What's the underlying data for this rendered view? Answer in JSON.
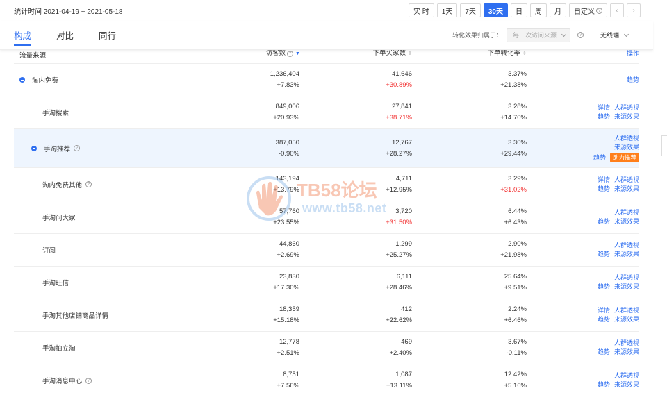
{
  "header": {
    "stat_time": "统计时间 2021-04-19 ~ 2021-05-18",
    "time_buttons": [
      "实 时",
      "1天",
      "7天",
      "30天",
      "日",
      "周",
      "月",
      "自定义"
    ],
    "active_time": "30天",
    "prev_icon": "chevron-left-icon",
    "next_icon": "chevron-right-icon"
  },
  "tabs": [
    {
      "label": "构成",
      "active": true
    },
    {
      "label": "对比",
      "active": false
    },
    {
      "label": "同行",
      "active": false
    }
  ],
  "attribution": {
    "label": "转化效果归属于：",
    "selected": "每一次访问来源",
    "device": "无线端"
  },
  "columns": {
    "source": "流量来源",
    "visitors": "访客数",
    "buyers": "下单买家数",
    "rate": "下单转化率",
    "ops": "操作"
  },
  "rows": [
    {
      "name": "淘内免费",
      "level": 0,
      "visitors": "1,236,404",
      "visitors_delta": "+7.83%",
      "buyers": "41,646",
      "buyers_delta": "+30.89%",
      "buyers_delta_red": true,
      "rate": "3.37%",
      "rate_delta": "+21.38%",
      "rate_delta_red": false,
      "ops_left": [
        "趋势"
      ],
      "ops_right": []
    },
    {
      "name": "手淘搜索",
      "level": 1,
      "visitors": "849,006",
      "visitors_delta": "+20.93%",
      "buyers": "27,841",
      "buyers_delta": "+38.71%",
      "buyers_delta_red": true,
      "rate": "3.28%",
      "rate_delta": "+14.70%",
      "rate_delta_red": false,
      "ops_left": [
        "详情",
        "趋势"
      ],
      "ops_right": [
        "人群透视",
        "来源效果"
      ]
    },
    {
      "name": "手淘推荐",
      "level": 1,
      "visitors": "387,050",
      "visitors_delta": "-0.90%",
      "buyers": "12,767",
      "buyers_delta": "+28.27%",
      "buyers_delta_red": false,
      "rate": "3.30%",
      "rate_delta": "+29.44%",
      "rate_delta_red": false,
      "ops_left": [
        "趋势"
      ],
      "ops_right": [
        "人群透视",
        "来源效果"
      ],
      "badge": "助力推荐"
    },
    {
      "name": "淘内免费其他",
      "level": 1,
      "visitors": "143,194",
      "visitors_delta": "+13.79%",
      "buyers": "4,711",
      "buyers_delta": "+12.95%",
      "buyers_delta_red": false,
      "rate": "3.29%",
      "rate_delta": "+31.02%",
      "rate_delta_red": true,
      "ops_left": [
        "详情",
        "趋势"
      ],
      "ops_right": [
        "人群透视",
        "来源效果"
      ]
    },
    {
      "name": "手淘问大家",
      "level": 1,
      "visitors": "57,760",
      "visitors_delta": "+23.55%",
      "buyers": "3,720",
      "buyers_delta": "+31.50%",
      "buyers_delta_red": true,
      "rate": "6.44%",
      "rate_delta": "+6.43%",
      "rate_delta_red": false,
      "ops_left": [
        "趋势"
      ],
      "ops_right": [
        "人群透视",
        "来源效果"
      ]
    },
    {
      "name": "订阅",
      "level": 1,
      "visitors": "44,860",
      "visitors_delta": "+2.69%",
      "buyers": "1,299",
      "buyers_delta": "+25.27%",
      "buyers_delta_red": false,
      "rate": "2.90%",
      "rate_delta": "+21.98%",
      "rate_delta_red": false,
      "ops_left": [
        "趋势"
      ],
      "ops_right": [
        "人群透视",
        "来源效果"
      ]
    },
    {
      "name": "手淘旺信",
      "level": 1,
      "visitors": "23,830",
      "visitors_delta": "+17.30%",
      "buyers": "6,111",
      "buyers_delta": "+28.46%",
      "buyers_delta_red": false,
      "rate": "25.64%",
      "rate_delta": "+9.51%",
      "rate_delta_red": false,
      "ops_left": [
        "趋势"
      ],
      "ops_right": [
        "人群透视",
        "来源效果"
      ]
    },
    {
      "name": "手淘其他店铺商品详情",
      "level": 1,
      "visitors": "18,359",
      "visitors_delta": "+15.18%",
      "buyers": "412",
      "buyers_delta": "+22.62%",
      "buyers_delta_red": false,
      "rate": "2.24%",
      "rate_delta": "+6.46%",
      "rate_delta_red": false,
      "ops_left": [
        "详情",
        "趋势"
      ],
      "ops_right": [
        "人群透视",
        "来源效果"
      ]
    },
    {
      "name": "手淘拍立淘",
      "level": 1,
      "visitors": "12,778",
      "visitors_delta": "+2.51%",
      "buyers": "469",
      "buyers_delta": "+2.40%",
      "buyers_delta_red": false,
      "rate": "3.67%",
      "rate_delta": "-0.11%",
      "rate_delta_red": false,
      "ops_left": [
        "趋势"
      ],
      "ops_right": [
        "人群透视",
        "来源效果"
      ]
    },
    {
      "name": "手淘消息中心",
      "level": 1,
      "visitors": "8,751",
      "visitors_delta": "+7.56%",
      "buyers": "1,087",
      "buyers_delta": "+13.11%",
      "buyers_delta_red": false,
      "rate": "12.42%",
      "rate_delta": "+5.16%",
      "rate_delta_red": false,
      "ops_left": [
        "趋势"
      ],
      "ops_right": [
        "人群透视",
        "来源效果"
      ]
    }
  ],
  "help_rows": [
    "手淘推荐",
    "淘内免费其他",
    "手淘消息中心"
  ],
  "watermark": {
    "line1": "TB58论坛",
    "line2": "www.tb58.net"
  },
  "colors": {
    "accent": "#2f6ff0",
    "negative": "#f23030",
    "badge": "#ff7f1b",
    "highlight_row": "#eef5fe"
  }
}
